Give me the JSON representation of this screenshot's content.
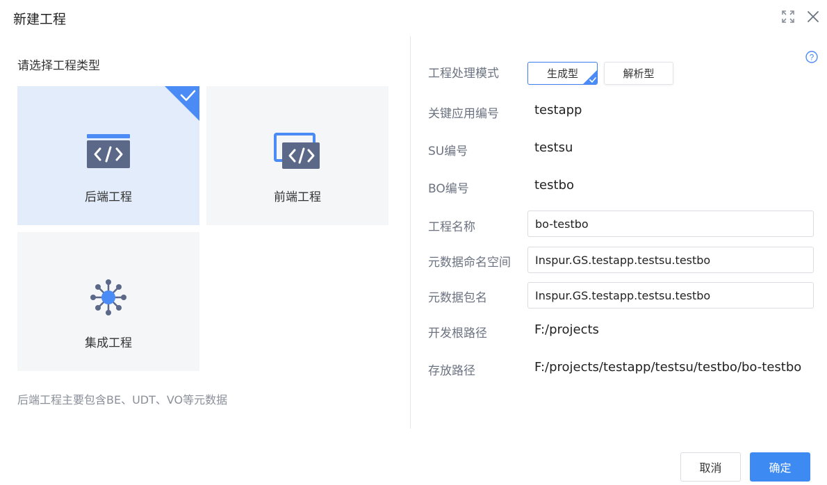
{
  "dialog": {
    "title": "新建工程"
  },
  "left": {
    "prompt": "请选择工程类型",
    "cards": [
      {
        "label": "后端工程",
        "icon": "backend-code-icon",
        "selected": true
      },
      {
        "label": "前端工程",
        "icon": "frontend-code-icon",
        "selected": false
      },
      {
        "label": "集成工程",
        "icon": "integration-hub-icon",
        "selected": false
      }
    ],
    "description": "后端工程主要包含BE、UDT、VO等元数据"
  },
  "form": {
    "mode_label": "工程处理模式",
    "modes": [
      {
        "label": "生成型",
        "active": true
      },
      {
        "label": "解析型",
        "active": false
      }
    ],
    "app_code_label": "关键应用编号",
    "app_code_value": "testapp",
    "su_label": "SU编号",
    "su_value": "testsu",
    "bo_label": "BO编号",
    "bo_value": "testbo",
    "project_name_label": "工程名称",
    "project_name_value": "bo-testbo",
    "namespace_label": "元数据命名空间",
    "namespace_value": "Inspur.GS.testapp.testsu.testbo",
    "package_label": "元数据包名",
    "package_value": "Inspur.GS.testapp.testsu.testbo",
    "root_path_label": "开发根路径",
    "root_path_value": "F:/projects",
    "save_path_label": "存放路径",
    "save_path_value": "F:/projects/testapp/testsu/testbo/bo-testbo"
  },
  "footer": {
    "cancel_label": "取消",
    "ok_label": "确定"
  },
  "colors": {
    "accent": "#3d8bf2",
    "selected_bg": "#e3ecfb",
    "card_bg": "#f5f6f8",
    "icon_dark": "#5b6888"
  }
}
